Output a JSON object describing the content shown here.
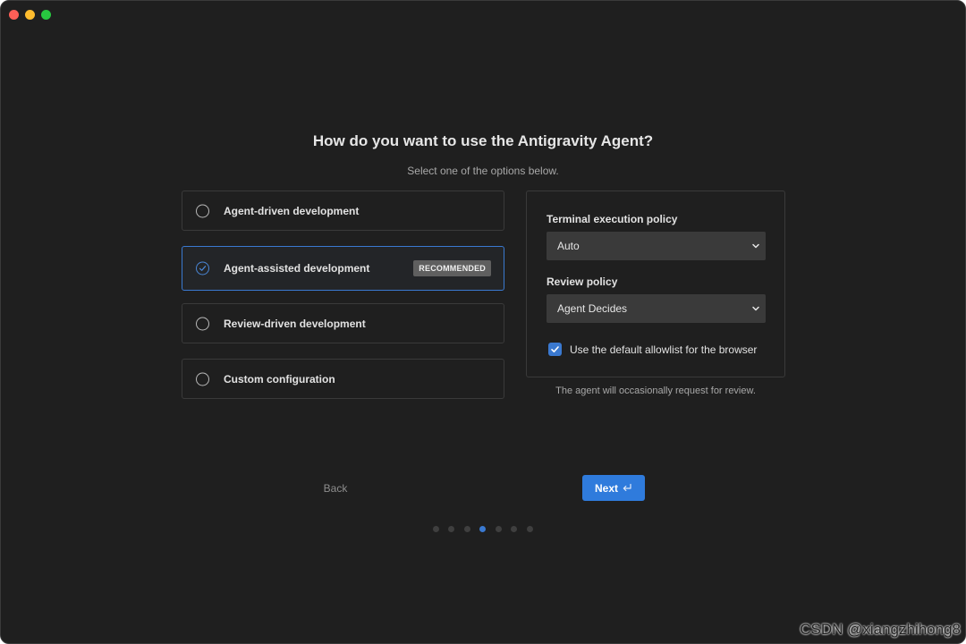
{
  "window": {
    "controls": [
      "close",
      "minimize",
      "zoom"
    ]
  },
  "header": {
    "title": "How do you want to use the Antigravity Agent?",
    "subtitle": "Select one of the options below."
  },
  "options": [
    {
      "label": "Agent-driven development",
      "selected": false
    },
    {
      "label": "Agent-assisted development",
      "selected": true,
      "badge": "RECOMMENDED"
    },
    {
      "label": "Review-driven development",
      "selected": false
    },
    {
      "label": "Custom configuration",
      "selected": false
    }
  ],
  "settings": {
    "terminal_policy_label": "Terminal execution policy",
    "terminal_policy_value": "Auto",
    "review_policy_label": "Review policy",
    "review_policy_value": "Agent Decides",
    "allowlist_label": "Use the default allowlist for the browser",
    "allowlist_checked": true,
    "note": "The agent will occasionally request for review."
  },
  "nav": {
    "back_label": "Back",
    "next_label": "Next"
  },
  "progress": {
    "total_steps": 7,
    "current_step": 4
  },
  "watermark": "CSDN @xiangzhihong8",
  "colors": {
    "background": "#1f1f1f",
    "accent": "#2f7bdc",
    "border": "#3a3a3a"
  }
}
